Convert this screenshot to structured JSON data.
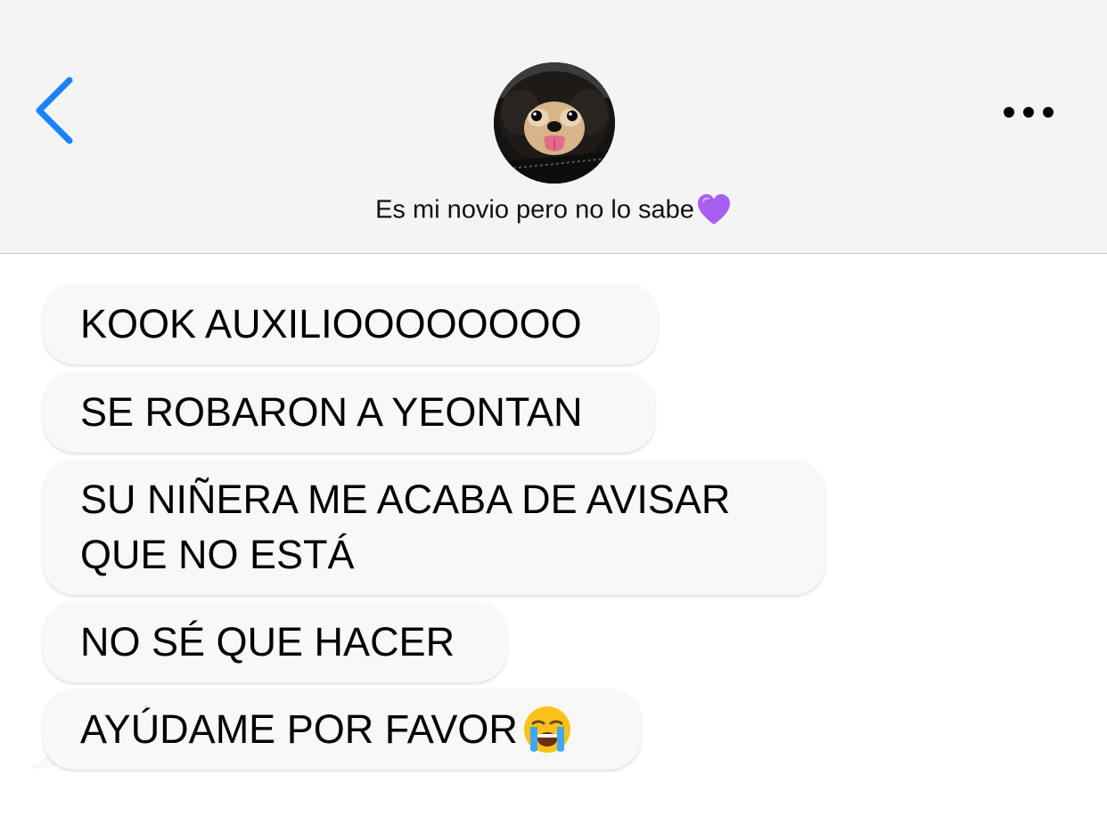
{
  "header": {
    "contact_name": "Es mi novio pero no lo sabe",
    "back_icon": "chevron-left-icon",
    "more_icon": "more-horizontal-icon",
    "heart_icon": "purple-heart-icon",
    "accent_color": "#1a82fb"
  },
  "messages": [
    {
      "lines": [
        "KOOK AUXILIOOOOOOOO"
      ]
    },
    {
      "lines": [
        "SE ROBARON A YEONTAN"
      ]
    },
    {
      "lines": [
        "SU NIÑERA ME ACABA DE AVISAR",
        "QUE NO ESTÁ"
      ]
    },
    {
      "lines": [
        "NO SÉ QUE HACER"
      ]
    },
    {
      "lines": [
        "AYÚDAME POR FAVOR"
      ],
      "emoji": "crying-face-icon"
    }
  ],
  "colors": {
    "header_bg": "#f4f4f4",
    "bubble_bg": "#f8f8f8",
    "heart": "#a95ef2"
  }
}
